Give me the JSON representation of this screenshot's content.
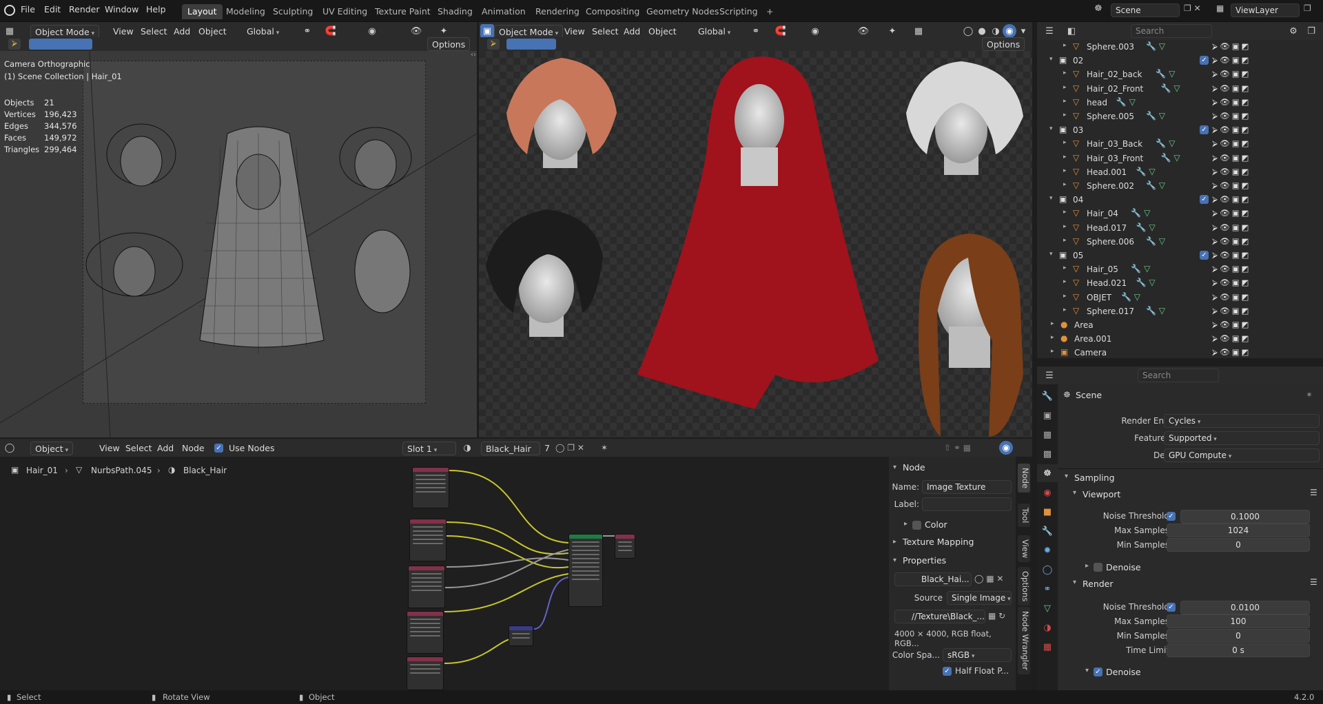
{
  "menu": [
    "File",
    "Edit",
    "Render",
    "Window",
    "Help"
  ],
  "workspaces": [
    {
      "label": "Layout",
      "active": true
    },
    {
      "label": "Modeling"
    },
    {
      "label": "Sculpting"
    },
    {
      "label": "UV Editing"
    },
    {
      "label": "Texture Paint"
    },
    {
      "label": "Shading"
    },
    {
      "label": "Animation"
    },
    {
      "label": "Rendering"
    },
    {
      "label": "Compositing"
    },
    {
      "label": "Geometry Nodes"
    },
    {
      "label": "Scripting"
    }
  ],
  "add_workspace": "+",
  "scene": {
    "name": "Scene",
    "viewlayer": "ViewLayer"
  },
  "viewport_left": {
    "mode": "Object Mode",
    "menus": [
      "View",
      "Select",
      "Add",
      "Object"
    ],
    "orientation": "Global",
    "options": "Options",
    "camera": "Camera Orthographic",
    "collection": "(1) Scene Collection | Hair_01",
    "stats": [
      {
        "label": "Objects",
        "value": "21"
      },
      {
        "label": "Vertices",
        "value": "196,423"
      },
      {
        "label": "Edges",
        "value": "344,576"
      },
      {
        "label": "Faces",
        "value": "149,972"
      },
      {
        "label": "Triangles",
        "value": "299,464"
      }
    ]
  },
  "viewport_right": {
    "mode": "Object Mode",
    "menus": [
      "View",
      "Select",
      "Add",
      "Object"
    ],
    "orientation": "Global",
    "options": "Options"
  },
  "outliner": {
    "search_placeholder": "Search",
    "rows": [
      {
        "indent": 2,
        "label": "Sphere.003",
        "type": "obj"
      },
      {
        "indent": 1,
        "label": "02",
        "type": "col"
      },
      {
        "indent": 2,
        "label": "Hair_02_back",
        "type": "obj"
      },
      {
        "indent": 2,
        "label": "Hair_02_Front",
        "type": "obj"
      },
      {
        "indent": 2,
        "label": "head",
        "type": "obj"
      },
      {
        "indent": 2,
        "label": "Sphere.005",
        "type": "obj"
      },
      {
        "indent": 1,
        "label": "03",
        "type": "col"
      },
      {
        "indent": 2,
        "label": "Hair_03_Back",
        "type": "obj"
      },
      {
        "indent": 2,
        "label": "Hair_03_Front",
        "type": "obj"
      },
      {
        "indent": 2,
        "label": "Head.001",
        "type": "obj"
      },
      {
        "indent": 2,
        "label": "Sphere.002",
        "type": "obj"
      },
      {
        "indent": 1,
        "label": "04",
        "type": "col"
      },
      {
        "indent": 2,
        "label": "Hair_04",
        "type": "obj"
      },
      {
        "indent": 2,
        "label": "Head.017",
        "type": "obj"
      },
      {
        "indent": 2,
        "label": "Sphere.006",
        "type": "obj"
      },
      {
        "indent": 1,
        "label": "05",
        "type": "col"
      },
      {
        "indent": 2,
        "label": "Hair_05",
        "type": "obj"
      },
      {
        "indent": 2,
        "label": "Head.021",
        "type": "obj"
      },
      {
        "indent": 2,
        "label": "OBJET",
        "type": "obj"
      },
      {
        "indent": 2,
        "label": "Sphere.017",
        "type": "obj"
      },
      {
        "indent": 1,
        "label": "Area",
        "type": "light"
      },
      {
        "indent": 1,
        "label": "Area.001",
        "type": "light"
      },
      {
        "indent": 1,
        "label": "Camera",
        "type": "cam"
      }
    ]
  },
  "properties": {
    "search_placeholder": "Search",
    "context": "Scene",
    "render_engine_label": "Render Engine",
    "render_engine": "Cycles",
    "feature_set_label": "Feature Set",
    "feature_set": "Supported",
    "device_label": "Device",
    "device": "GPU Compute",
    "sampling": "Sampling",
    "viewport": "Viewport",
    "vp_noise_label": "Noise Threshold",
    "vp_noise": "0.1000",
    "vp_max_label": "Max Samples",
    "vp_max": "1024",
    "vp_min_label": "Min Samples",
    "vp_min": "0",
    "denoise": "Denoise",
    "render": "Render",
    "r_noise_label": "Noise Threshold",
    "r_noise": "0.0100",
    "r_max_label": "Max Samples",
    "r_max": "100",
    "r_min_label": "Min Samples",
    "r_min": "0",
    "r_time_label": "Time Limit",
    "r_time": "0 s",
    "denoise2": "Denoise"
  },
  "node_editor": {
    "type": "Object",
    "menus": [
      "View",
      "Select",
      "Add",
      "Node"
    ],
    "use_nodes": "Use Nodes",
    "slot": "Slot 1",
    "material": "Black_Hair",
    "users": "7",
    "breadcrumb": [
      "Hair_01",
      "NurbsPath.045",
      "Black_Hair"
    ]
  },
  "node_panel": {
    "node": "Node",
    "name_label": "Name:",
    "name": "Image Texture",
    "label_label": "Label:",
    "color": "Color",
    "texture_mapping": "Texture Mapping",
    "properties": "Properties",
    "image": "Black_Hai...",
    "source_label": "Source",
    "source": "Single Image",
    "filepath": "//Texture\\Black_...",
    "info": "4000 × 4000, RGB float, RGB...",
    "colorspace_label": "Color Spa...",
    "colorspace": "sRGB",
    "half_float": "Half Float P..."
  },
  "side_tabs": [
    "Node",
    "Tool",
    "View",
    "Options",
    "Node Wrangler"
  ],
  "status": {
    "select": "Select",
    "rotate": "Rotate View",
    "object": "Object",
    "version": "4.2.0"
  }
}
